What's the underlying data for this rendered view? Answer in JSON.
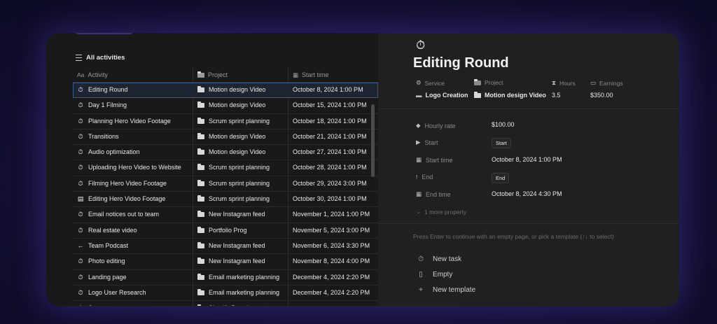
{
  "view": {
    "title": "All activities"
  },
  "columns": {
    "activity": "Activity",
    "project": "Project",
    "start_time": "Start time",
    "activity_prefix": "Aa"
  },
  "rows": [
    {
      "activity": "Editing Round",
      "project": "Motion design Video",
      "start": "October 8, 2024 1:00 PM",
      "icon": "stopwatch-icon",
      "glyph": "⏱"
    },
    {
      "activity": "Day 1 Filming",
      "project": "Motion design Video",
      "start": "October 15, 2024 1:00 PM",
      "icon": "stopwatch-icon",
      "glyph": "⏱"
    },
    {
      "activity": "Planning Hero Video Footage",
      "project": "Scrum sprint planning",
      "start": "October 18, 2024 1:00 PM",
      "icon": "stopwatch-icon",
      "glyph": "⏱"
    },
    {
      "activity": "Transitions",
      "project": "Motion design Video",
      "start": "October 21, 2024 1:00 PM",
      "icon": "stopwatch-icon",
      "glyph": "⏱"
    },
    {
      "activity": "Audio optimization",
      "project": "Motion design Video",
      "start": "October 27, 2024 1:00 PM",
      "icon": "stopwatch-icon",
      "glyph": "⏱"
    },
    {
      "activity": "Uploading Hero Video to Website",
      "project": "Scrum sprint planning",
      "start": "October 28, 2024 1:00 PM",
      "icon": "stopwatch-icon",
      "glyph": "⏱"
    },
    {
      "activity": "Filming Hero Video Footage",
      "project": "Scrum sprint planning",
      "start": "October 29, 2024 3:00 PM",
      "icon": "stopwatch-icon",
      "glyph": "⏱"
    },
    {
      "activity": "Editing Hero Video Footage",
      "project": "Scrum sprint planning",
      "start": "October 30, 2024 1:00 PM",
      "icon": "archive-icon",
      "glyph": "▤"
    },
    {
      "activity": "Email notices out to team",
      "project": "New Instagram feed",
      "start": "November 1, 2024 1:00 PM",
      "icon": "stopwatch-icon",
      "glyph": "⏱"
    },
    {
      "activity": "Real estate video",
      "project": "Portfolio Prog",
      "start": "November 5, 2024 3:00 PM",
      "icon": "stopwatch-icon",
      "glyph": "⏱"
    },
    {
      "activity": "Team Podcast",
      "project": "New Instagram feed",
      "start": "November 6, 2024 3:30 PM",
      "icon": "arrow-left-icon",
      "glyph": "←"
    },
    {
      "activity": "Photo editing",
      "project": "New Instagram feed",
      "start": "November 8, 2024 4:00 PM",
      "icon": "stopwatch-icon",
      "glyph": "⏱"
    },
    {
      "activity": "Landing page",
      "project": "Email marketing planning",
      "start": "December 4, 2024 2:20 PM",
      "icon": "stopwatch-icon",
      "glyph": "⏱"
    },
    {
      "activity": "Logo User Research",
      "project": "Email marketing planning",
      "start": "December 4, 2024 2:20 PM",
      "icon": "stopwatch-icon",
      "glyph": "⏱"
    },
    {
      "activity": "Store",
      "project": "Shopify Brand",
      "start": "",
      "icon": "stopwatch-icon",
      "glyph": "⏱"
    }
  ],
  "page": {
    "title": "Editing Round",
    "props": {
      "service_label": "Service",
      "service_value": "Logo Creation",
      "project_label": "Project",
      "project_value": "Motion design Video",
      "hours_label": "Hours",
      "hours_value": "3.5",
      "earnings_label": "Earnings",
      "earnings_value": "$350.00"
    },
    "hourly_rate_label": "Hourly rate",
    "hourly_rate_value": "$100.00",
    "start_label": "Start",
    "start_button": "Start",
    "start_time_label": "Start time",
    "start_time_value": "October 8, 2024 1:00 PM",
    "end_label": "End",
    "end_button": "End",
    "end_time_label": "End time",
    "end_time_value": "October 8, 2024 4:30 PM",
    "more_properties": "1 more property",
    "hint": "Press Enter to continue with an empty page, or pick a template (↑↓ to select)",
    "templates": [
      {
        "label": "New task",
        "icon": "stopwatch-icon",
        "glyph": "⏱"
      },
      {
        "label": "Empty",
        "icon": "page-icon",
        "glyph": "▯"
      },
      {
        "label": "New template",
        "icon": "plus-icon",
        "glyph": "+"
      }
    ]
  },
  "colors": {
    "background": "#16123a",
    "panel_left": "#191919",
    "panel_right": "#202020",
    "selection": "#3a5a8a"
  }
}
